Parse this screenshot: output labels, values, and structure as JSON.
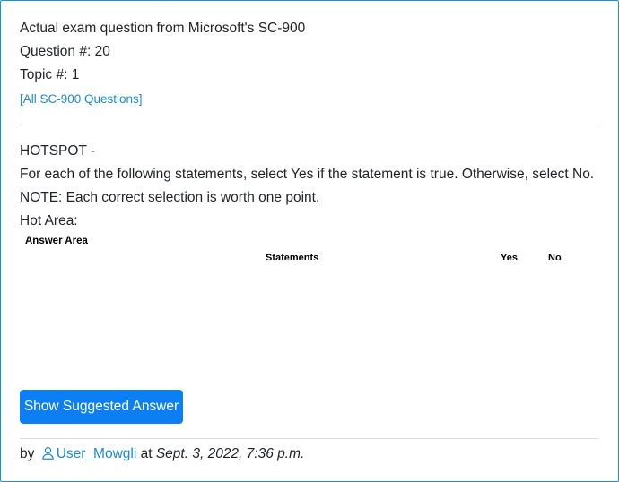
{
  "header": {
    "exam_title": "Actual exam question from Microsoft's SC-900",
    "question_number": "Question #: 20",
    "topic_number": "Topic #: 1",
    "all_questions_link": "[All SC-900 Questions]"
  },
  "question": {
    "type_label": "HOTSPOT -",
    "instruction": "For each of the following statements, select Yes if the statement is true. Otherwise, select No.",
    "note": "NOTE: Each correct selection is worth one point.",
    "hot_area_label": "Hot Area:",
    "image": {
      "answer_area_label": "Answer Area",
      "statements_header": "Statements",
      "yes_header": "Yes",
      "no_header": "No"
    }
  },
  "actions": {
    "show_answer_label": "Show Suggested Answer"
  },
  "footer": {
    "by_label": "by",
    "user_icon": "user-outline-icon",
    "username": "User_Mowgli",
    "at_label": "at",
    "timestamp": "Sept. 3, 2022, 7:36 p.m."
  },
  "colors": {
    "border": "#1e90d6",
    "link": "#1a8ad6",
    "button_bg": "#0d7ff5",
    "button_text": "#ffffff"
  }
}
